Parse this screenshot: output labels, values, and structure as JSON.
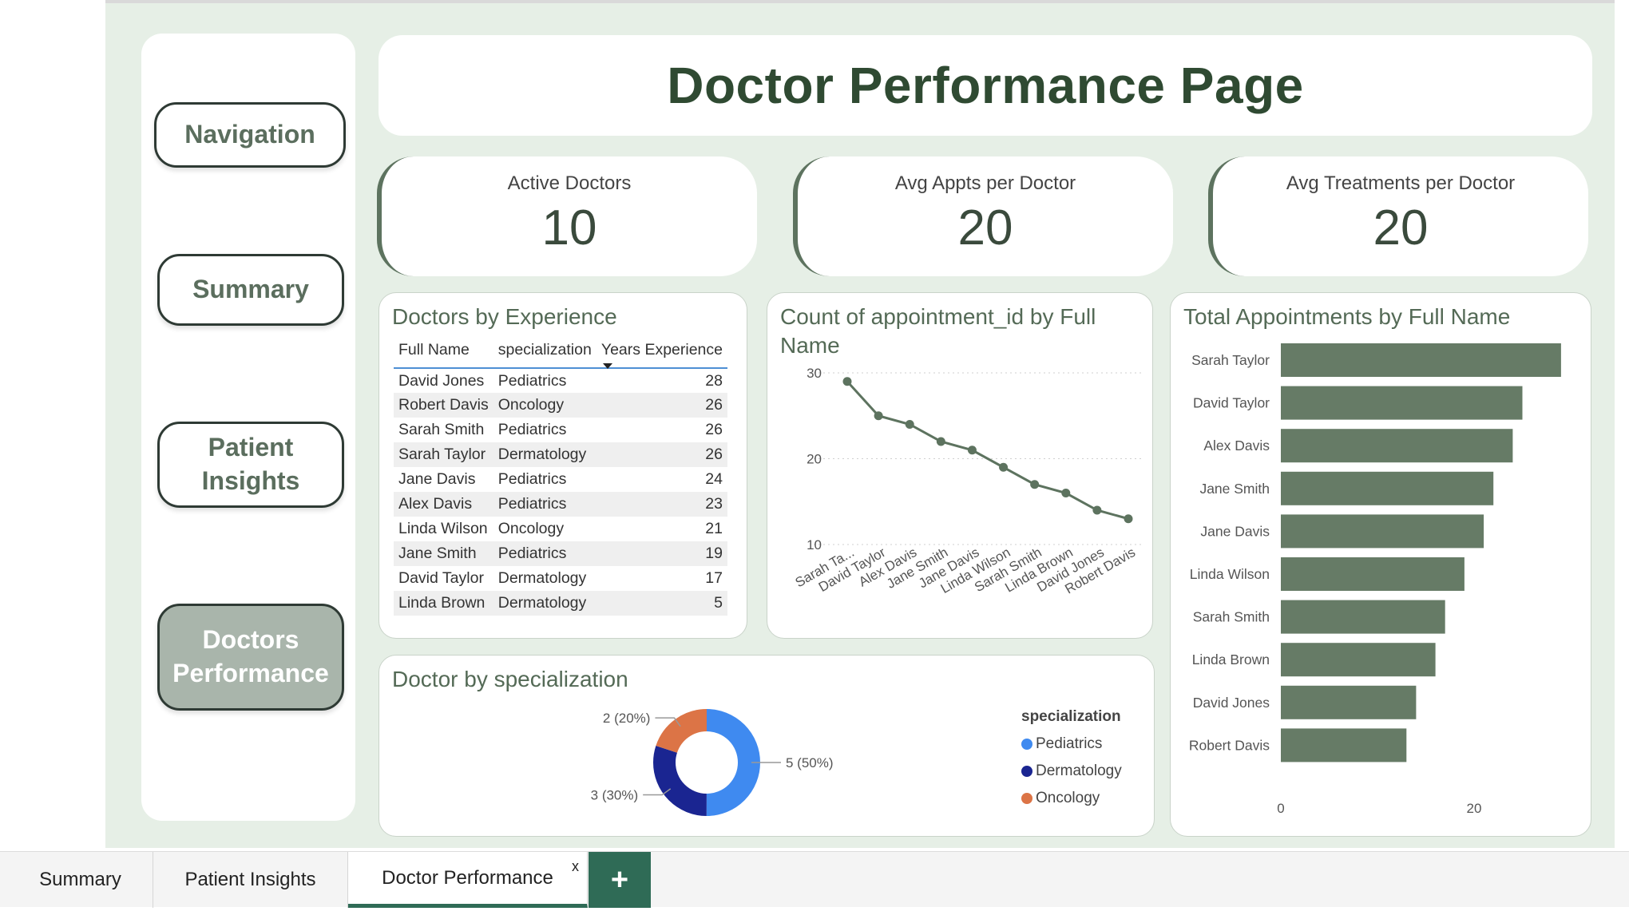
{
  "page": {
    "title": "Doctor Performance Page"
  },
  "nav": {
    "items": [
      {
        "label": "Navigation",
        "active": false
      },
      {
        "label": "Summary",
        "active": false
      },
      {
        "label": "Patient\nInsights",
        "active": false
      },
      {
        "label": "Doctors\nPerformance",
        "active": true
      }
    ]
  },
  "kpis": [
    {
      "label": "Active Doctors",
      "value": "10"
    },
    {
      "label": "Avg Appts per Doctor",
      "value": "20"
    },
    {
      "label": "Avg Treatments per Doctor",
      "value": "20"
    }
  ],
  "table": {
    "title": "Doctors by Experience",
    "columns": [
      "Full Name",
      "specialization",
      "Years Experience"
    ],
    "rows": [
      [
        "David Jones",
        "Pediatrics",
        "28"
      ],
      [
        "Robert Davis",
        "Oncology",
        "26"
      ],
      [
        "Sarah Smith",
        "Pediatrics",
        "26"
      ],
      [
        "Sarah Taylor",
        "Dermatology",
        "26"
      ],
      [
        "Jane Davis",
        "Pediatrics",
        "24"
      ],
      [
        "Alex Davis",
        "Pediatrics",
        "23"
      ],
      [
        "Linda Wilson",
        "Oncology",
        "21"
      ],
      [
        "Jane Smith",
        "Pediatrics",
        "19"
      ],
      [
        "David Taylor",
        "Dermatology",
        "17"
      ],
      [
        "Linda Brown",
        "Dermatology",
        "5"
      ]
    ]
  },
  "chart_data": [
    {
      "type": "line",
      "title": "Count of appointment_id by Full Name",
      "categories": [
        "Sarah Ta...",
        "David Taylor",
        "Alex Davis",
        "Jane Smith",
        "Jane Davis",
        "Linda Wilson",
        "Sarah Smith",
        "Linda Brown",
        "David Jones",
        "Robert Davis"
      ],
      "values": [
        29,
        25,
        24,
        22,
        21,
        19,
        17,
        16,
        14,
        13
      ],
      "ylim": [
        10,
        30
      ],
      "yticks": [
        10,
        20,
        30
      ],
      "grid": true,
      "color": "#5d735f"
    },
    {
      "type": "bar",
      "orientation": "horizontal",
      "title": "Total Appointments by Full Name",
      "categories": [
        "Sarah Taylor",
        "David Taylor",
        "Alex Davis",
        "Jane Smith",
        "Jane Davis",
        "Linda Wilson",
        "Sarah Smith",
        "Linda Brown",
        "David Jones",
        "Robert Davis"
      ],
      "values": [
        29,
        25,
        24,
        22,
        21,
        19,
        17,
        16,
        14,
        13
      ],
      "xlim": [
        0,
        30
      ],
      "xticks": [
        0,
        20
      ],
      "color": "#667b66"
    },
    {
      "type": "pie",
      "variant": "donut",
      "title": "Doctor by specialization",
      "legend_title": "specialization",
      "legend_position": "right",
      "slices": [
        {
          "label": "Pediatrics",
          "value": 5,
          "display": "5 (50%)",
          "color": "#3f8af0"
        },
        {
          "label": "Dermatology",
          "value": 3,
          "display": "3 (30%)",
          "color": "#1a2591"
        },
        {
          "label": "Oncology",
          "value": 2,
          "display": "2 (20%)",
          "color": "#dc7446"
        }
      ]
    }
  ],
  "tabs": {
    "items": [
      {
        "label": "Summary",
        "active": false
      },
      {
        "label": "Patient Insights",
        "active": false
      },
      {
        "label": "Doctor Performance",
        "active": true
      }
    ],
    "close_label": "x",
    "add_label": "+"
  }
}
